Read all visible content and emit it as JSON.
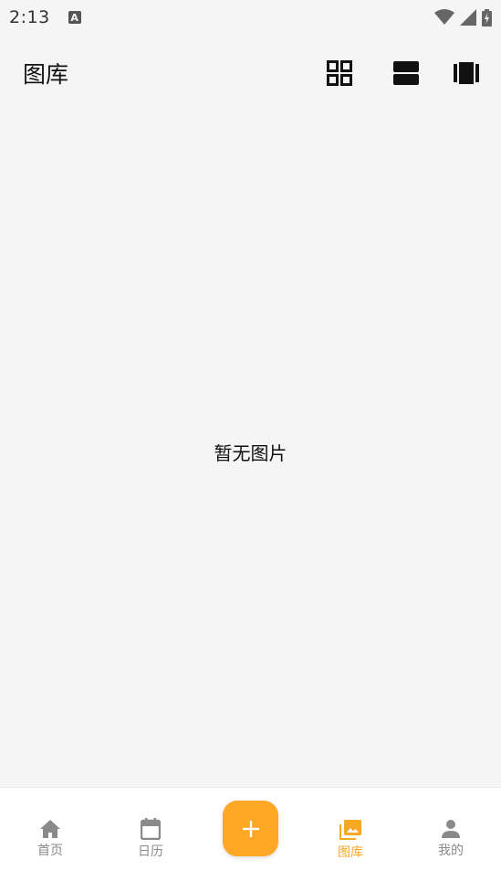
{
  "status_bar": {
    "time": "2:13",
    "notification_icon": "a-icon",
    "icons": [
      "wifi-icon",
      "signal-icon",
      "battery-charging-icon"
    ]
  },
  "header": {
    "title": "图库",
    "view_modes": [
      "grid-view-icon",
      "list-view-icon",
      "carousel-view-icon"
    ]
  },
  "main": {
    "empty_message": "暂无图片"
  },
  "bottom_nav": {
    "items": [
      {
        "label": "首页",
        "icon": "home-icon"
      },
      {
        "label": "日历",
        "icon": "calendar-icon"
      },
      {
        "label": "",
        "icon": "plus-icon"
      },
      {
        "label": "图库",
        "icon": "gallery-icon"
      },
      {
        "label": "我的",
        "icon": "person-icon"
      }
    ],
    "active_index": 3
  },
  "colors": {
    "accent": "#ffa726",
    "active_label": "#f7a825",
    "inactive": "#8a8a8a",
    "background": "#f5f5f5"
  }
}
